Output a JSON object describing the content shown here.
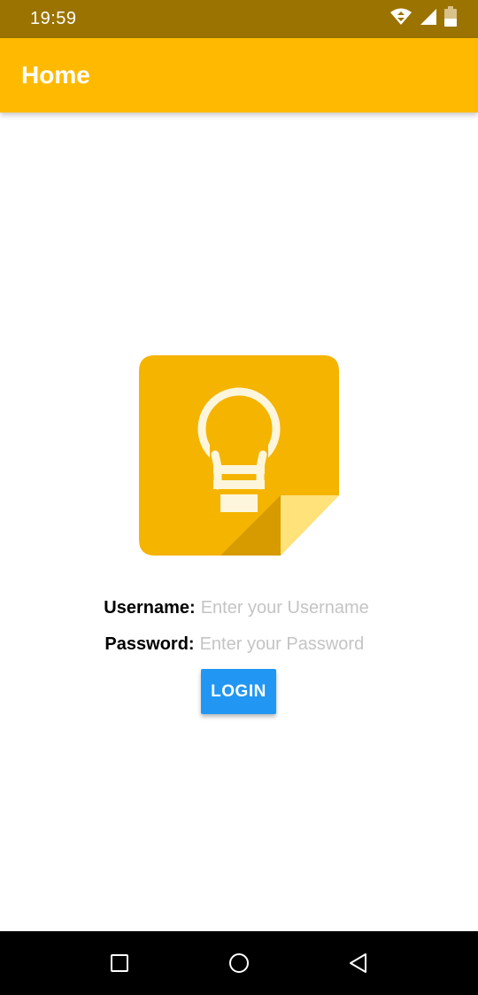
{
  "status_bar": {
    "time": "19:59",
    "background": "#9b7300",
    "icons": [
      "wifi-icon",
      "signal-icon",
      "battery-icon"
    ]
  },
  "app_bar": {
    "title": "Home",
    "background": "#ffba00"
  },
  "logo": {
    "icon": "lightbulb-note-icon",
    "color": "#f4b400"
  },
  "form": {
    "username": {
      "label": "Username:",
      "placeholder": "Enter your Username",
      "value": ""
    },
    "password": {
      "label": "Password:",
      "placeholder": "Enter your Password",
      "value": ""
    },
    "login_label": "LOGIN",
    "login_color": "#2196f3"
  },
  "nav_bar": {
    "icons": [
      "recents-square-icon",
      "home-circle-icon",
      "back-triangle-icon"
    ]
  }
}
